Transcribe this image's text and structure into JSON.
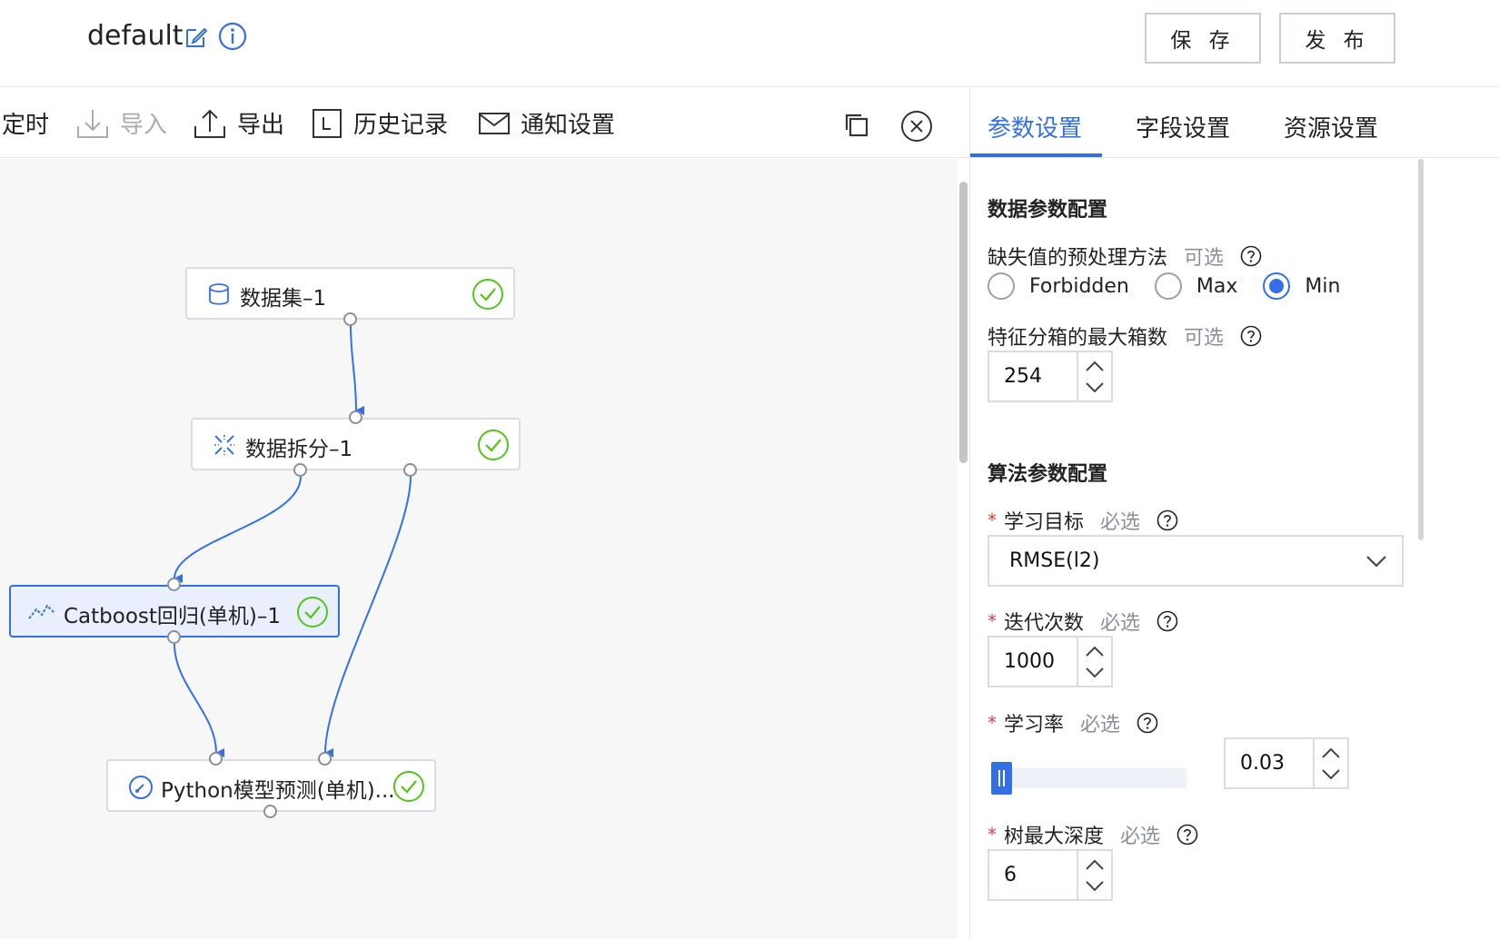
{
  "header": {
    "title": "default",
    "save_label": "保 存",
    "publish_label": "发 布"
  },
  "toolbar": {
    "schedule": "定时",
    "import": "导入",
    "export": "导出",
    "history": "历史记录",
    "notify": "通知设置"
  },
  "nodes": [
    {
      "label": "数据集–1",
      "icon": "database-icon",
      "status": "success"
    },
    {
      "label": "数据拆分–1",
      "icon": "split-icon",
      "status": "success"
    },
    {
      "label": "Catboost回归(单机)–1",
      "icon": "regression-icon",
      "status": "success",
      "selected": true
    },
    {
      "label": "Python模型预测(单机)...",
      "icon": "gauge-icon",
      "status": "success"
    }
  ],
  "tabs": [
    "参数设置",
    "字段设置",
    "资源设置"
  ],
  "panel": {
    "data_section": "数据参数配置",
    "missing_label": "缺失值的预处理方法",
    "optional": "可选",
    "radio_options": [
      "Forbidden",
      "Max",
      "Min"
    ],
    "radio_selected": "Min",
    "bins_label": "特征分箱的最大箱数",
    "bins_value": "254",
    "algo_section": "算法参数配置",
    "objective_label": "学习目标",
    "required": "必选",
    "objective_value": "RMSE(l2)",
    "iterations_label": "迭代次数",
    "iterations_value": "1000",
    "lr_label": "学习率",
    "lr_value": "0.03",
    "lr_slider_fraction": 0.03,
    "depth_label": "树最大深度",
    "depth_value": "6"
  },
  "colors": {
    "accent": "#3370e6",
    "success": "#52c41a",
    "required": "#e53e3e"
  }
}
